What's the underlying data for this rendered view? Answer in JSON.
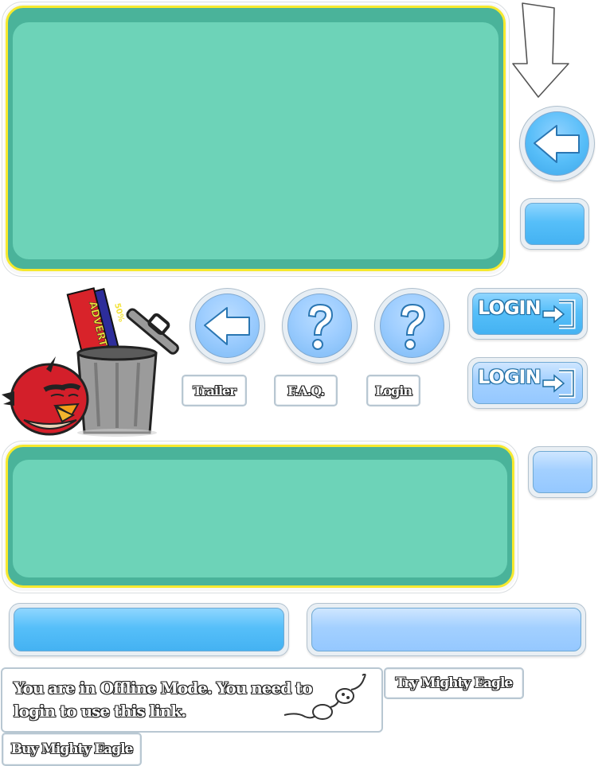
{
  "hud": {
    "labels": {
      "trailer": "Trailer",
      "faq": "F.A.Q.",
      "login": "Login",
      "try_eagle": "Try Mighty Eagle",
      "buy_eagle": "Buy Mighty Eagle"
    },
    "login_buttons": [
      {
        "text": "LOGIN",
        "state": "normal"
      },
      {
        "text": "LOGIN",
        "state": "hover"
      }
    ],
    "offline_message": "You are in Offline Mode. You need to login to use this link.",
    "trash_sign_main": "ADVERTISEMENT",
    "trash_sign_small": "50%"
  },
  "icons": {
    "back_arrow": "back-arrow-icon",
    "question": "question-icon",
    "login_door": "login-door-icon",
    "down_arrow": "down-arrow-icon",
    "plug": "unplugged-plug-icon",
    "bird": "red-bird-icon",
    "trash": "trash-can-icon"
  },
  "colors": {
    "panel_teal": "#6dd3b8",
    "panel_teal_dark": "#4ab39a",
    "panel_rim": "#f6e92e",
    "button_sky": "#4fbaf6",
    "button_pale": "#9fceff"
  }
}
